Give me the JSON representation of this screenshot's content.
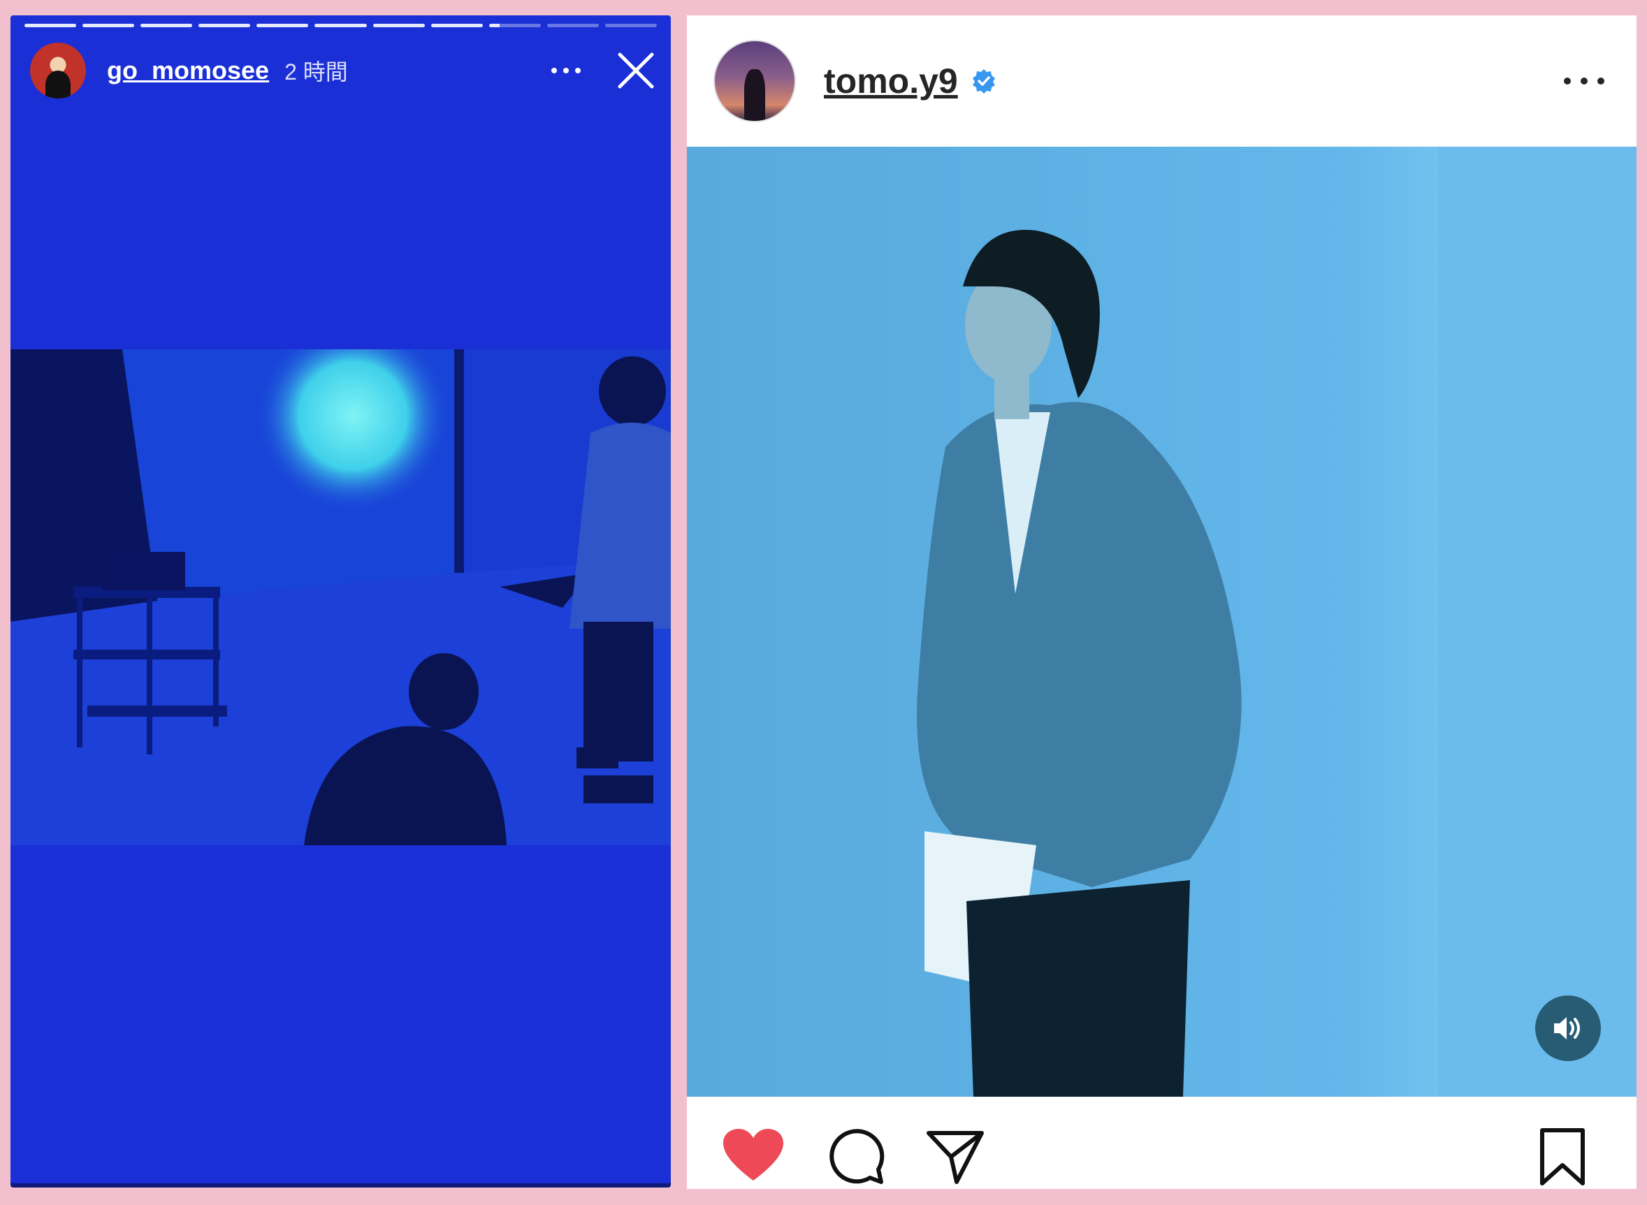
{
  "story": {
    "username": "go_momosee",
    "time_ago": "2 時間",
    "progress_segments": [
      1,
      1,
      1,
      1,
      1,
      1,
      1,
      1,
      0.2,
      0,
      0
    ],
    "icons": {
      "more": "more-horizontal-icon",
      "close": "close-icon"
    },
    "background_color": "#1a2fd6"
  },
  "post": {
    "username": "tomo.y9",
    "verified": true,
    "icons": {
      "verified": "verified-badge-icon",
      "more": "more-horizontal-icon",
      "sound": "sound-on-icon",
      "like": "heart-filled-icon",
      "comment": "comment-icon",
      "share": "send-icon",
      "save": "bookmark-icon"
    },
    "liked": true,
    "accent_color": "#3897f0",
    "like_color": "#ed4956"
  },
  "page": {
    "background_color": "#f2bfcf"
  }
}
